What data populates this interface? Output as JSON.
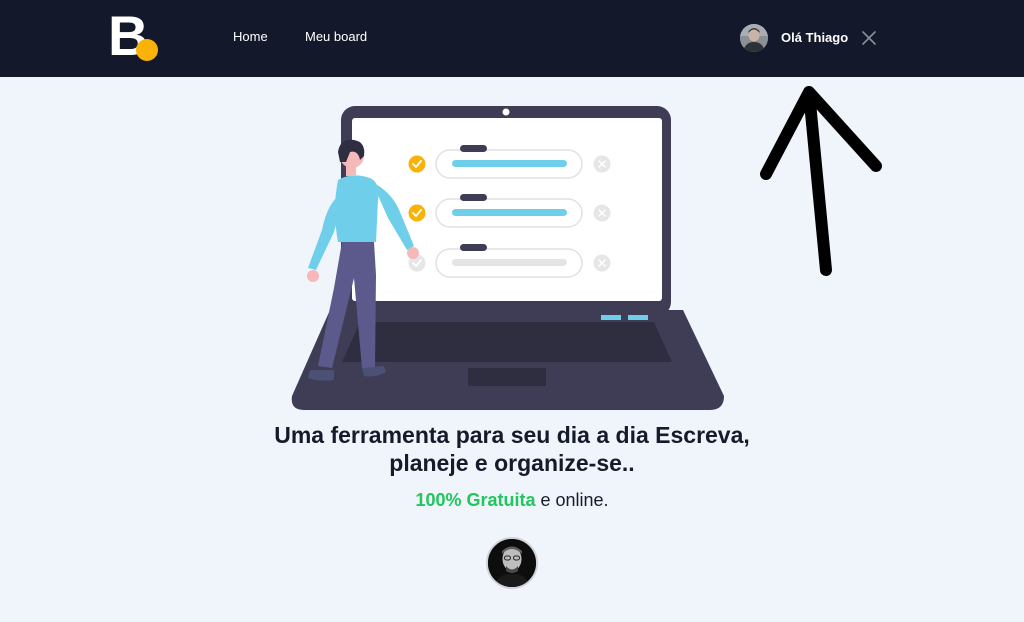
{
  "brand": {
    "letter": "B",
    "accent_color": "#f9b208",
    "logo_icon": "brand-logo-icon"
  },
  "nav": {
    "links": [
      "Home",
      "Meu board"
    ],
    "greeting": "Olá Thiago",
    "close_icon": "close-icon",
    "background": "#13182a"
  },
  "hero": {
    "illustration": "person-at-laptop-checklist-illustration",
    "checklist": [
      {
        "checked": true
      },
      {
        "checked": true
      },
      {
        "checked": false
      }
    ],
    "headline_line1": "Uma ferramenta para seu dia a dia Escreva,",
    "headline_line2": "planeje e organize-se..",
    "tagline_highlight": "100% Gratuita",
    "tagline_rest": " e online.",
    "highlight_color": "#22c55e"
  }
}
